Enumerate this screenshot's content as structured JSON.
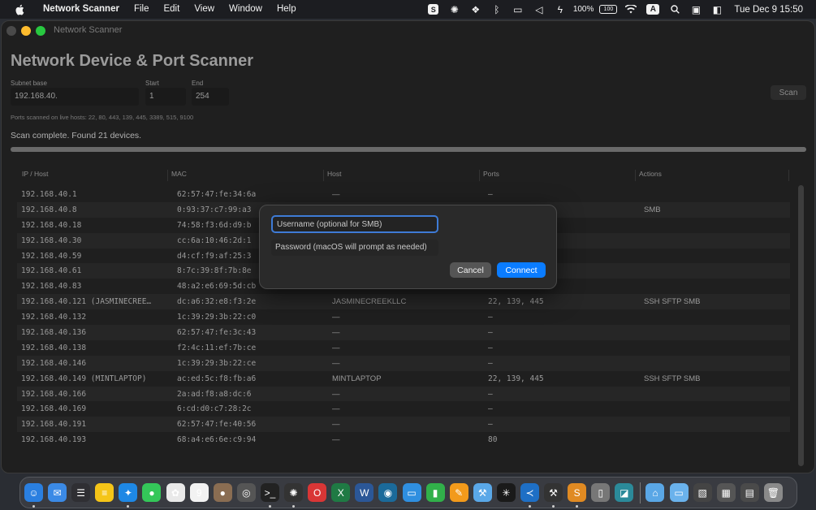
{
  "menubar": {
    "app_name": "Network Scanner",
    "menus": [
      "File",
      "Edit",
      "View",
      "Window",
      "Help"
    ],
    "battery_percent": "100%",
    "battery_label": "100",
    "input_source": "A",
    "clock": "Tue Dec 9  15:50",
    "status_icons": [
      "skype-icon",
      "chatgpt-icon",
      "dropbox-icon",
      "bluetooth-icon",
      "display-icon",
      "mute-icon",
      "power-icon"
    ]
  },
  "window": {
    "title": "Network Scanner",
    "page_title": "Network Device & Port Scanner"
  },
  "form": {
    "subnet_label": "Subnet base",
    "subnet_value": "192.168.40.",
    "start_label": "Start",
    "start_value": "1",
    "end_label": "End",
    "end_value": "254",
    "scan_label": "Scan",
    "ports_note": "Ports scanned on live hosts: 22, 80, 443, 139, 445, 3389, 515, 9100"
  },
  "scan": {
    "status": "Scan complete. Found 21 devices.",
    "progress": 1.0
  },
  "table": {
    "headers": [
      "IP / Host",
      "MAC",
      "Host",
      "Ports",
      "Actions"
    ],
    "rows": [
      {
        "ip": "192.168.40.1",
        "mac": "62:57:47:fe:34:6a",
        "host": "—",
        "ports": "—",
        "actions": ""
      },
      {
        "ip": "192.168.40.8",
        "mac": "0:93:37:c7:99:a3",
        "host": "",
        "ports": "",
        "actions": "SMB"
      },
      {
        "ip": "192.168.40.18",
        "mac": "74:58:f3:6d:d9:b",
        "host": "",
        "ports": "",
        "actions": ""
      },
      {
        "ip": "192.168.40.30",
        "mac": "cc:6a:10:46:2d:1",
        "host": "",
        "ports": "",
        "actions": ""
      },
      {
        "ip": "192.168.40.59",
        "mac": "d4:cf:f9:af:25:3",
        "host": "",
        "ports": "",
        "actions": ""
      },
      {
        "ip": "192.168.40.61",
        "mac": "8:7c:39:8f:7b:8e",
        "host": "",
        "ports": "",
        "actions": ""
      },
      {
        "ip": "192.168.40.83",
        "mac": "48:a2:e6:69:5d:cb",
        "host": "",
        "ports": "",
        "actions": ""
      },
      {
        "ip": "192.168.40.121 (JASMINECREE…",
        "mac": "dc:a6:32:e8:f3:2e",
        "host": "JASMINECREEKLLC",
        "ports": "22, 139, 445",
        "actions": "SSH  SFTP  SMB"
      },
      {
        "ip": "192.168.40.132",
        "mac": "1c:39:29:3b:22:c0",
        "host": "—",
        "ports": "—",
        "actions": ""
      },
      {
        "ip": "192.168.40.136",
        "mac": "62:57:47:fe:3c:43",
        "host": "—",
        "ports": "—",
        "actions": ""
      },
      {
        "ip": "192.168.40.138",
        "mac": "f2:4c:11:ef:7b:ce",
        "host": "—",
        "ports": "—",
        "actions": ""
      },
      {
        "ip": "192.168.40.146",
        "mac": "1c:39:29:3b:22:ce",
        "host": "—",
        "ports": "—",
        "actions": ""
      },
      {
        "ip": "192.168.40.149 (MINTLAPTOP)",
        "mac": "ac:ed:5c:f8:fb:a6",
        "host": "MINTLAPTOP",
        "ports": "22, 139, 445",
        "actions": "SSH  SFTP  SMB"
      },
      {
        "ip": "192.168.40.166",
        "mac": "2a:ad:f8:a8:dc:6",
        "host": "—",
        "ports": "—",
        "actions": ""
      },
      {
        "ip": "192.168.40.169",
        "mac": "6:cd:d0:c7:28:2c",
        "host": "—",
        "ports": "—",
        "actions": ""
      },
      {
        "ip": "192.168.40.191",
        "mac": "62:57:47:fe:40:56",
        "host": "—",
        "ports": "—",
        "actions": ""
      },
      {
        "ip": "192.168.40.193",
        "mac": "68:a4:e6:6e:c9:94",
        "host": "—",
        "ports": "80",
        "actions": ""
      }
    ]
  },
  "dialog": {
    "username_placeholder": "Username (optional for SMB)",
    "password_placeholder": "Password (macOS will prompt as needed)",
    "cancel_label": "Cancel",
    "connect_label": "Connect"
  },
  "dock": {
    "apps": [
      {
        "name": "finder-icon",
        "color": "#2a7fe0",
        "glyph": "☺",
        "running": true
      },
      {
        "name": "mail-icon",
        "color": "#3b8ae6",
        "glyph": "✉",
        "running": false
      },
      {
        "name": "reminders-icon",
        "color": "#2f2f33",
        "glyph": "☰",
        "running": false
      },
      {
        "name": "notes-icon",
        "color": "#f5c518",
        "glyph": "≡",
        "running": false
      },
      {
        "name": "safari-icon",
        "color": "#1e88e5",
        "glyph": "✦",
        "running": true
      },
      {
        "name": "messages-icon",
        "color": "#34c759",
        "glyph": "●",
        "running": false
      },
      {
        "name": "photos-icon",
        "color": "#e9e9e9",
        "glyph": "✿",
        "running": false
      },
      {
        "name": "calendar-icon",
        "color": "#f2f2f2",
        "glyph": "9",
        "running": false
      },
      {
        "name": "contacts-icon",
        "color": "#8a6d52",
        "glyph": "●",
        "running": false
      },
      {
        "name": "chrome-icon",
        "color": "#555",
        "glyph": "◎",
        "running": false
      },
      {
        "name": "terminal-icon",
        "color": "#222",
        "glyph": ">_",
        "running": true
      },
      {
        "name": "chatgpt-icon",
        "color": "#333",
        "glyph": "✺",
        "running": true
      },
      {
        "name": "opera-icon",
        "color": "#d93636",
        "glyph": "O",
        "running": false
      },
      {
        "name": "excel-icon",
        "color": "#1f7a44",
        "glyph": "X",
        "running": false
      },
      {
        "name": "word-icon",
        "color": "#2b5797",
        "glyph": "W",
        "running": false
      },
      {
        "name": "steam-icon",
        "color": "#1b6a9a",
        "glyph": "◉",
        "running": false
      },
      {
        "name": "keynote-icon",
        "color": "#2f8fe0",
        "glyph": "▭",
        "running": false
      },
      {
        "name": "numbers-icon",
        "color": "#31b04a",
        "glyph": "▮",
        "running": false
      },
      {
        "name": "pages-icon",
        "color": "#f29a1b",
        "glyph": "✎",
        "running": false
      },
      {
        "name": "xcode-icon",
        "color": "#5aa8e8",
        "glyph": "⚒",
        "running": false
      },
      {
        "name": "network-icon",
        "color": "#1a1a1a",
        "glyph": "✳",
        "running": false
      },
      {
        "name": "vscode-icon",
        "color": "#1e6fc5",
        "glyph": "≺",
        "running": true
      },
      {
        "name": "hammer-icon",
        "color": "#333",
        "glyph": "⚒",
        "running": true
      },
      {
        "name": "sublime-icon",
        "color": "#e08a22",
        "glyph": "S",
        "running": true
      },
      {
        "name": "preview-icon",
        "color": "#777",
        "glyph": "▯",
        "running": false
      },
      {
        "name": "screen-icon",
        "color": "#2b8a9a",
        "glyph": "◪",
        "running": false
      }
    ],
    "folders": [
      {
        "name": "applications-folder-icon",
        "color": "#5aa7e6",
        "glyph": "⌂"
      },
      {
        "name": "documents-folder-icon",
        "color": "#6ab2ec",
        "glyph": "▭"
      },
      {
        "name": "downloads-stack-icon",
        "color": "#444",
        "glyph": "▧"
      },
      {
        "name": "screenshots-stack-icon",
        "color": "#555",
        "glyph": "▦"
      },
      {
        "name": "desktop-stack-icon",
        "color": "#4a4a4a",
        "glyph": "▤"
      },
      {
        "name": "trash-icon",
        "color": "#8a8a8a",
        "glyph": "🗑"
      }
    ]
  }
}
